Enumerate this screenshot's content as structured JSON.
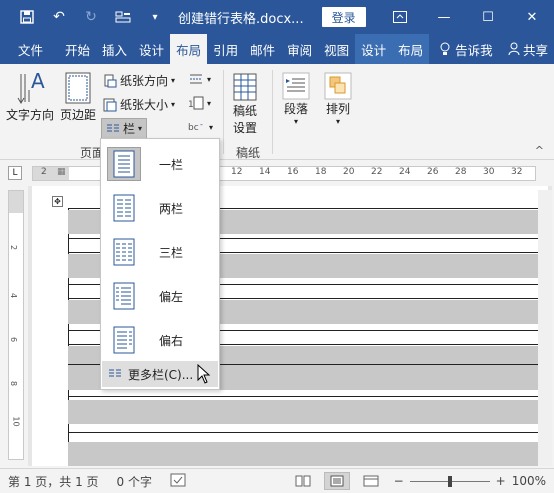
{
  "titlebar": {
    "title": "创建错行表格.docx...",
    "login": "登录",
    "icons": [
      "save-icon",
      "undo-icon",
      "redo-icon",
      "form-icon",
      "customize-qat-icon"
    ]
  },
  "tabs": {
    "file": "文件",
    "home": "开始",
    "insert": "插入",
    "design": "设计",
    "layout": "布局",
    "references": "引用",
    "mailings": "邮件",
    "review": "审阅",
    "view": "视图",
    "table_design": "设计",
    "table_layout": "布局",
    "tell_me": "告诉我",
    "share": "共享"
  },
  "ribbon": {
    "text_direction": "文字方向",
    "margins": "页边距",
    "orientation": "纸张方向",
    "size": "纸张大小",
    "columns": "栏",
    "group_page": "页面",
    "manuscript_settings_1": "稿纸",
    "manuscript_settings_2": "设置",
    "group_manuscript": "稿纸",
    "paragraph": "段落",
    "arrange": "排列"
  },
  "ruler": {
    "ticks": [
      "2",
      "12",
      "14",
      "16",
      "18",
      "20",
      "22",
      "24",
      "26",
      "28",
      "30",
      "32"
    ],
    "vticks": [
      "2",
      "4",
      "6",
      "8",
      "10"
    ]
  },
  "columns_menu": {
    "items": [
      {
        "label": "一栏",
        "icon": "one-column-icon"
      },
      {
        "label": "两栏",
        "icon": "two-columns-icon"
      },
      {
        "label": "三栏",
        "icon": "three-columns-icon"
      },
      {
        "label": "偏左",
        "icon": "left-column-icon"
      },
      {
        "label": "偏右",
        "icon": "right-column-icon"
      }
    ],
    "more": "更多栏(C)..."
  },
  "statusbar": {
    "page": "第 1 页，共 1 页",
    "words": "0 个字",
    "zoom": "100%",
    "zoom_minus": "−",
    "zoom_plus": "+"
  },
  "colors": {
    "accent": "#2b579a",
    "ribbon_bg": "#f3f3f3",
    "table_row_gray": "#c8c8c8"
  }
}
